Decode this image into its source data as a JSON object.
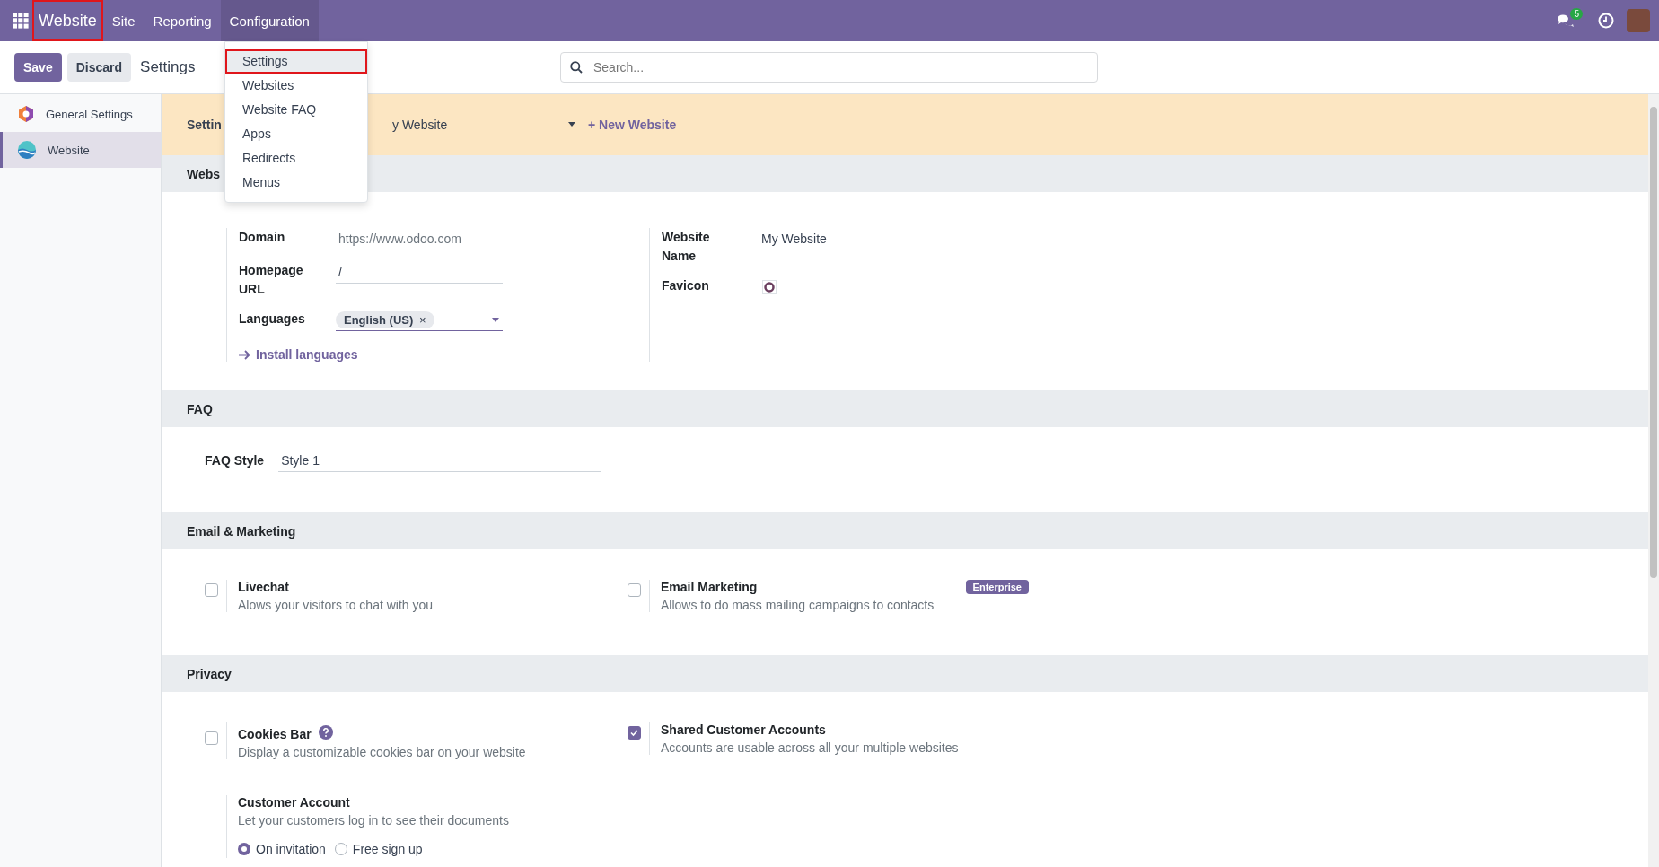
{
  "navbar": {
    "brand": {
      "label": "Website",
      "highlighted": true
    },
    "menus": [
      {
        "label": "Site",
        "selected": false
      },
      {
        "label": "Reporting",
        "selected": false
      },
      {
        "label": "Configuration",
        "selected": true
      }
    ],
    "chat_badge": "5"
  },
  "control_panel": {
    "save": "Save",
    "discard": "Discard",
    "breadcrumb": "Settings",
    "search": {
      "placeholder": "Search..."
    }
  },
  "dropdown_menu": {
    "items": [
      {
        "label": "Settings",
        "selected": true,
        "highlighted": true
      },
      {
        "label": "Websites",
        "selected": false,
        "highlighted": false
      },
      {
        "label": "Website FAQ",
        "selected": false,
        "highlighted": false
      },
      {
        "label": "Apps",
        "selected": false,
        "highlighted": false
      },
      {
        "label": "Redirects",
        "selected": false,
        "highlighted": false
      },
      {
        "label": "Menus",
        "selected": false,
        "highlighted": false
      }
    ]
  },
  "sidebar": {
    "items": [
      {
        "label": "General Settings",
        "kind": "general",
        "selected": false
      },
      {
        "label": "Website",
        "kind": "website",
        "selected": true
      }
    ]
  },
  "banner": {
    "label": "Settin",
    "website_select": "y Website",
    "new_website": "+ New Website"
  },
  "sections": [
    {
      "kind": "fields",
      "title": "Webs",
      "columns": [
        {
          "fields": [
            {
              "kind": "text",
              "label": "Domain",
              "placeholder": "https://www.odoo.com",
              "focused": false
            },
            {
              "kind": "text",
              "label": "Homepage URL",
              "value": "/",
              "focused": false
            },
            {
              "kind": "tags",
              "label": "Languages",
              "tags": [
                {
                  "label": "English (US)",
                  "remove": "×"
                }
              ],
              "focused": true
            }
          ],
          "link": "Install languages"
        },
        {
          "fields": [
            {
              "kind": "text",
              "label": "Website Name",
              "value": "My Website",
              "focused": true
            },
            {
              "kind": "image",
              "label": "Favicon"
            }
          ]
        }
      ]
    },
    {
      "kind": "single",
      "title": "FAQ",
      "field": {
        "label": "FAQ Style",
        "value": "Style 1"
      }
    },
    {
      "kind": "settings",
      "title": "Email & Marketing",
      "items": [
        {
          "kind": "checkbox",
          "title": "Livechat",
          "description": "Alows your visitors to chat with you",
          "checked": false
        },
        {
          "kind": "checkbox",
          "title": "Email Marketing",
          "description": "Allows to do mass mailing campaigns to contacts",
          "checked": false,
          "badge": "Enterprise"
        }
      ]
    },
    {
      "kind": "settings",
      "title": "Privacy",
      "items": [
        {
          "kind": "checkbox",
          "title": "Cookies Bar",
          "description": "Display a customizable cookies bar on your website",
          "checked": false,
          "help": true
        },
        {
          "kind": "checkbox",
          "title": "Shared Customer Accounts",
          "description": "Accounts are usable across all your multiple websites",
          "checked": true
        },
        {
          "kind": "radio",
          "title": "Customer Account",
          "description": "Let your customers log in to see their documents",
          "options": [
            {
              "label": "On invitation",
              "selected": true
            },
            {
              "label": "Free sign up",
              "selected": false
            }
          ]
        }
      ]
    }
  ]
}
